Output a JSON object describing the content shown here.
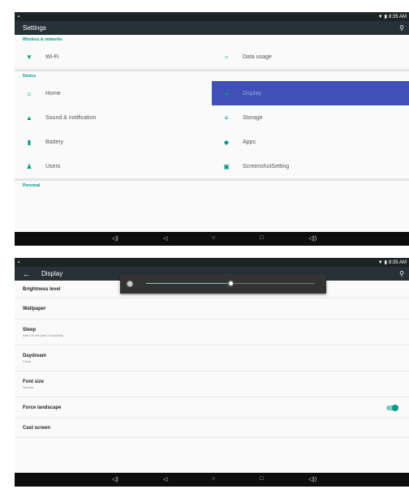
{
  "statusbar": {
    "time": "8:35 AM"
  },
  "screen1": {
    "title": "Settings",
    "sections": {
      "wireless": "Wireless & networks",
      "device": "Device",
      "personal": "Personal"
    },
    "wireless_items": [
      {
        "label": "Wi-Fi",
        "icon": "wifi-icon"
      },
      {
        "label": "Data usage",
        "icon": "data-usage-icon"
      }
    ],
    "device_items": [
      {
        "label": "Home",
        "icon": "home-icon"
      },
      {
        "label": "Display",
        "icon": "display-icon"
      },
      {
        "label": "Sound & notification",
        "icon": "bell-icon"
      },
      {
        "label": "Storage",
        "icon": "storage-icon"
      },
      {
        "label": "Battery",
        "icon": "battery-icon"
      },
      {
        "label": "Apps",
        "icon": "apps-icon"
      },
      {
        "label": "Users",
        "icon": "users-icon"
      },
      {
        "label": "ScreenshotSetting",
        "icon": "screenshot-icon"
      }
    ]
  },
  "screen2": {
    "title": "Display",
    "brightness_level": 0.5,
    "items": [
      {
        "title": "Brightness level",
        "subtitle": ""
      },
      {
        "title": "Wallpaper",
        "subtitle": ""
      },
      {
        "title": "Sleep",
        "subtitle": "After 30 minutes of inactivity"
      },
      {
        "title": "Daydream",
        "subtitle": "Clock"
      },
      {
        "title": "Font size",
        "subtitle": "Normal"
      },
      {
        "title": "Force landscape",
        "subtitle": "",
        "toggle_on": true
      },
      {
        "title": "Cast screen",
        "subtitle": ""
      }
    ]
  },
  "colors": {
    "accent": "#009688",
    "selected": "#3f51b5",
    "appbar": "#263238",
    "statusbar": "#1c2525",
    "navbar": "#0d0d0d"
  }
}
